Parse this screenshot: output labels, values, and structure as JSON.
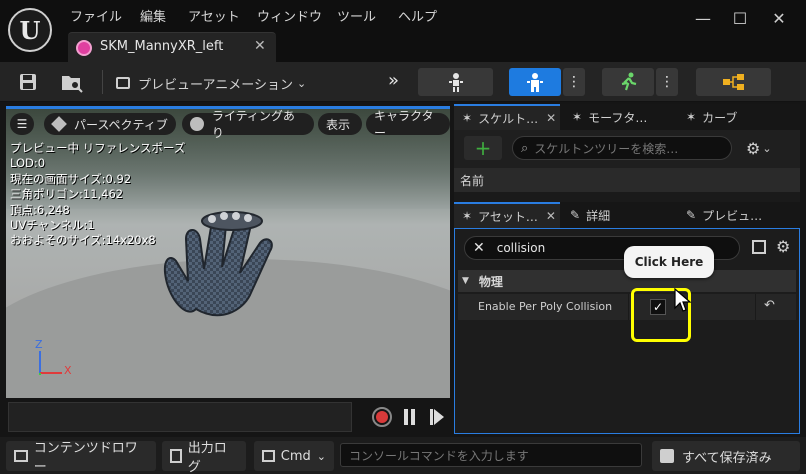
{
  "menu": {
    "file": "ファイル",
    "edit": "編集",
    "asset": "アセット",
    "window": "ウィンドウ",
    "tools": "ツール",
    "help": "ヘルプ"
  },
  "tab": {
    "title": "SKM_MannyXR_left"
  },
  "toolbar": {
    "preview_animation": "プレビューアニメーション"
  },
  "viewport": {
    "perspective": "パースペクティブ",
    "lighting": "ライティングあり",
    "show": "表示",
    "character": "キャラクター",
    "stats": [
      "プレビュー中 リファレンスポーズ",
      "LOD:0",
      "現在の画面サイズ:0.92",
      "三角ポリゴン:11,462",
      "頂点:6,248",
      "UVチャンネル:1",
      "おおよそのサイズ:14x20x8"
    ],
    "axis_z": "Z",
    "axis_x": "X"
  },
  "skeleton_panel": {
    "tabs": [
      "スケルト…",
      "モーフタ…",
      "カーブ"
    ],
    "search_placeholder": "スケルトンツリーを検索…",
    "name_header": "名前"
  },
  "details_panel": {
    "tabs": [
      "アセット…",
      "詳細",
      "プレビュ…"
    ],
    "search_value": "collision",
    "category": "物理",
    "property_label": "Enable Per Poly Collision",
    "property_checked": true
  },
  "tooltip": {
    "text": "Click Here"
  },
  "bottom": {
    "content_drawer": "コンテンツドロワー",
    "output_log": "出力ログ",
    "cmd": "Cmd",
    "console_placeholder": "コンソールコマンドを入力します",
    "save_all": "すべて保存済み"
  },
  "colors": {
    "accent": "#2a7de1",
    "highlight": "#ffff00",
    "add_green": "#3fae3f"
  }
}
